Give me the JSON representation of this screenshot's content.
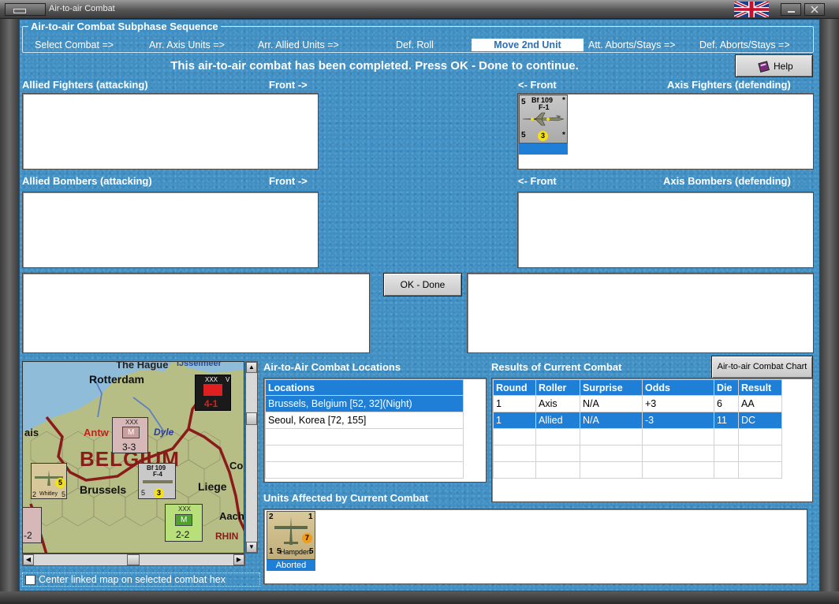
{
  "window": {
    "title": "Air-to-air Combat"
  },
  "subphase": {
    "legend": "Air-to-air Combat Subphase Sequence",
    "steps": [
      "Select Combat =>",
      "Arr. Axis Units =>",
      "Arr. Allied Units =>",
      "Def. Roll",
      "Move 2nd Unit",
      "Att. Aborts/Stays =>",
      "Def. Aborts/Stays =>"
    ],
    "active_step": "Move 2nd Unit"
  },
  "banner": "This air-to-air combat has been completed.  Press OK - Done to continue.",
  "help_button": "Help",
  "sections": {
    "allied_fighters": "Allied Fighters (attacking)",
    "allied_fighters_front": "Front ->",
    "axis_fighters_front": "<- Front",
    "axis_fighters": "Axis Fighters (defending)",
    "allied_bombers": "Allied Bombers (attacking)",
    "allied_bombers_front": "Front ->",
    "axis_bombers_front": "<- Front",
    "axis_bombers": "Axis Bombers (defending)"
  },
  "axis_fighter_unit": {
    "name": "Bf 109",
    "model": "F-1",
    "top_left": "5",
    "bottom_left": "5",
    "badge": "3",
    "star": "*"
  },
  "ok_button": "OK - Done",
  "locations": {
    "label": "Air-to-Air Combat Locations",
    "header": "Locations",
    "items": [
      "Brussels, Belgium [52, 32](Night)",
      "Seoul, Korea [72, 155]",
      "",
      "",
      ""
    ]
  },
  "results": {
    "label": "Results of Current Combat",
    "chart_button": "Air-to-air Combat Chart",
    "columns": [
      "Round",
      "Roller",
      "Surprise",
      "Odds",
      "Die",
      "Result"
    ],
    "rows": [
      [
        "1",
        "Axis",
        "N/A",
        "+3",
        "6",
        "AA"
      ],
      [
        "1",
        "Allied",
        "N/A",
        "-3",
        "11",
        "DC"
      ],
      [
        "",
        "",
        "",
        "",
        "",
        ""
      ],
      [
        "",
        "",
        "",
        "",
        "",
        ""
      ],
      [
        "",
        "",
        "",
        "",
        "",
        ""
      ]
    ]
  },
  "affected": {
    "label": "Units Affected by Current Combat",
    "unit": {
      "name": "Hampden",
      "top_left": "2",
      "top_right": "1",
      "bottom_left": "1",
      "bottom_right": "5",
      "bottom_mid": "5",
      "badge": "7",
      "status": "Aborted"
    }
  },
  "map": {
    "labels": {
      "rotterdam": "Rotterdam",
      "belgium": "BELGIUM",
      "brussels": "Brussels",
      "liege": "Liege",
      "antw": "Antw",
      "dyle": "Dyle",
      "aach": "Aach",
      "rhin": "RHIN",
      "ais": "ais",
      "co": "Co",
      "hague": "The Hague",
      "issel": "IJsselmeer"
    },
    "units": {
      "armor_value": "4-1",
      "armor_xxx": "XXX",
      "armor_v": "V",
      "infantry_value": "3-3",
      "infantry_xxx": "XXX",
      "inf_m": "M",
      "green_value": "2-2",
      "green_xxx": "XXX",
      "green_m": "M",
      "plane1_name": "Whitley",
      "plane1_badge": "5",
      "plane1_left": "2",
      "plane1_right": "5",
      "plane2_name": "Bf 109",
      "plane2_model": "F-4",
      "plane2_badge": "3",
      "plane2_left": "5",
      "edge_value": "-2"
    }
  },
  "center_map_checkbox": {
    "label": "Center linked map on selected combat hex",
    "checked": false
  }
}
